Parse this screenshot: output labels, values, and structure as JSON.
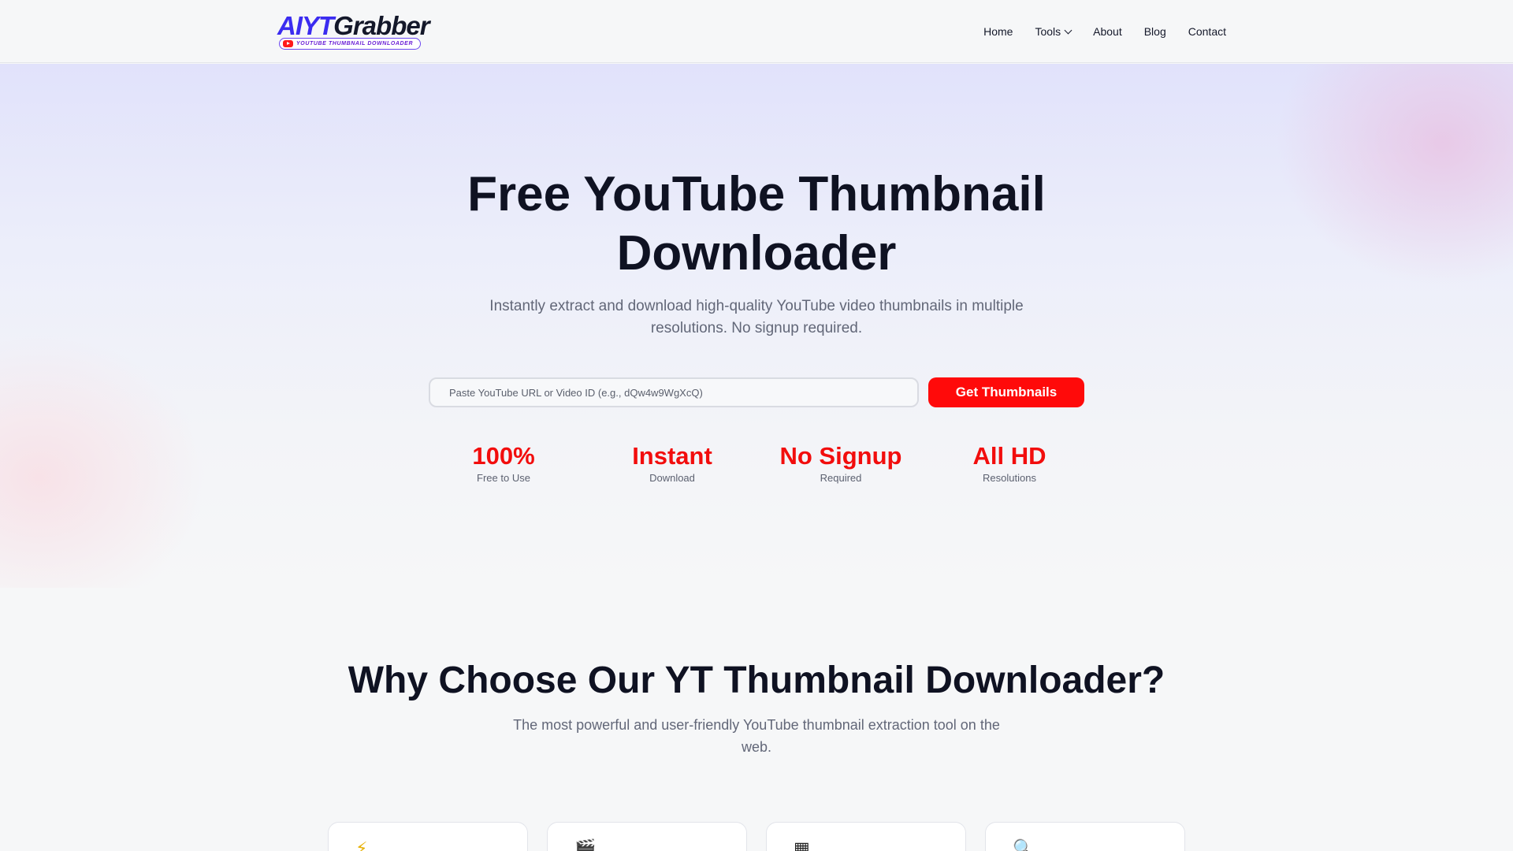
{
  "header": {
    "logo": {
      "brand_ai": "AIYT",
      "brand_rest": "Grabber",
      "tagline": "YOUTUBE THUMBNAIL DOWNLOADER"
    },
    "nav": [
      {
        "label": "Home"
      },
      {
        "label": "Tools",
        "has_dropdown": true
      },
      {
        "label": "About"
      },
      {
        "label": "Blog"
      },
      {
        "label": "Contact"
      }
    ]
  },
  "hero": {
    "title": "Free YouTube Thumbnail Downloader",
    "subtitle": "Instantly extract and download high-quality YouTube video thumbnails in multiple resolutions. No signup required.",
    "search": {
      "placeholder": "Paste YouTube URL or Video ID (e.g., dQw4w9WgXcQ)",
      "value": ""
    },
    "button_label": "Get Thumbnails",
    "stats": [
      {
        "value": "100%",
        "label": "Free to Use"
      },
      {
        "value": "Instant",
        "label": "Download"
      },
      {
        "value": "No Signup",
        "label": "Required"
      },
      {
        "value": "All HD",
        "label": "Resolutions"
      }
    ]
  },
  "why": {
    "title": "Why Choose Our YT Thumbnail Downloader?",
    "subtitle": "The most powerful and user-friendly YouTube thumbnail extraction tool on the web.",
    "cards": [
      {
        "icon": "lightning-icon",
        "glyph": "⚡"
      },
      {
        "icon": "clapperboard-icon",
        "glyph": "🎬"
      },
      {
        "icon": "grid-icon",
        "glyph": "▦"
      },
      {
        "icon": "magnifier-icon",
        "glyph": "🔍"
      }
    ]
  },
  "colors": {
    "accent": "#ff0a0a",
    "brand": "#3b2cf0",
    "text": "#0f1222",
    "muted": "#626778"
  }
}
